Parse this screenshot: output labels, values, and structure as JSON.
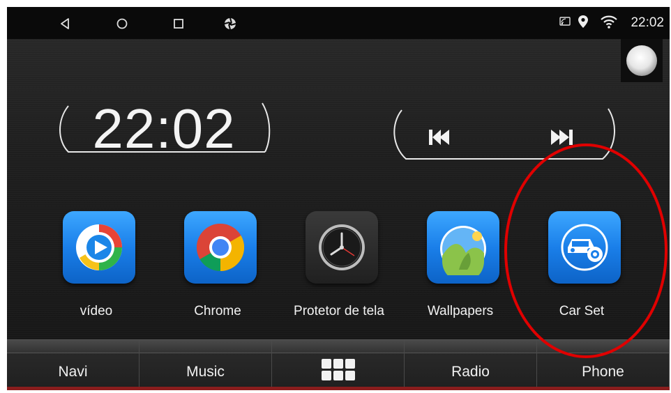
{
  "statusbar": {
    "nav_icons": [
      "back-icon",
      "home-icon",
      "recents-icon",
      "aperture-icon"
    ],
    "status_icons": [
      "cast-icon",
      "location-icon",
      "wifi-icon"
    ],
    "time": "22:02"
  },
  "clock_widget": {
    "time": "22:02"
  },
  "media_widget": {
    "buttons": [
      "previous-icon",
      "next-icon"
    ]
  },
  "apps": [
    {
      "label": "vídeo",
      "icon": "video-player-icon"
    },
    {
      "label": "Chrome",
      "icon": "chrome-icon"
    },
    {
      "label": "Protetor de tela",
      "icon": "clock-icon"
    },
    {
      "label": "Wallpapers",
      "icon": "wallpapers-icon"
    },
    {
      "label": "Car Set",
      "icon": "car-settings-icon"
    }
  ],
  "dock": {
    "navi": "Navi",
    "music": "Music",
    "apps_icon": "app-grid-icon",
    "radio": "Radio",
    "phone": "Phone"
  },
  "colors": {
    "annotation": "#e00000",
    "accent_blue": "#1a7fe9",
    "dock_bottom": "#8a1d1d"
  }
}
